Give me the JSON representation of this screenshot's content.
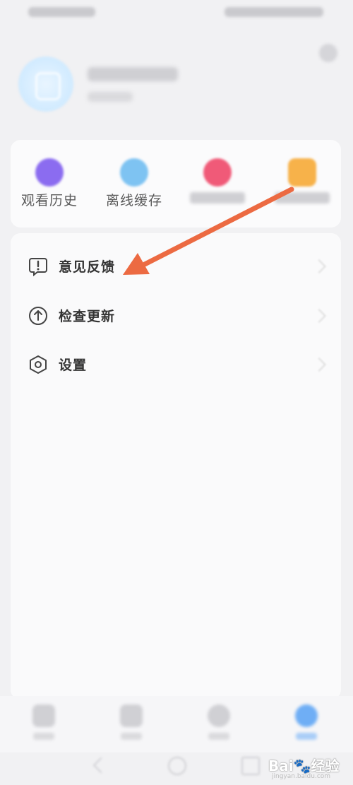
{
  "shortcuts": [
    {
      "label": "观看历史",
      "color": "#8b6cf0"
    },
    {
      "label": "离线缓存",
      "color": "#7ec3f2"
    },
    {
      "label": "",
      "color": "#f05a78"
    },
    {
      "label": "",
      "color": "#f7b24a"
    }
  ],
  "menu": {
    "items": [
      {
        "label": "意见反馈",
        "icon": "feedback-icon"
      },
      {
        "label": "检查更新",
        "icon": "update-icon"
      },
      {
        "label": "设置",
        "icon": "settings-icon"
      }
    ]
  },
  "annotation": {
    "arrow_color": "#ec6a42"
  },
  "bottom_nav": {
    "accent": "#6faef5"
  },
  "watermark": {
    "brand": "Bai🐾经验",
    "url": "jingyan.baidu.com"
  }
}
